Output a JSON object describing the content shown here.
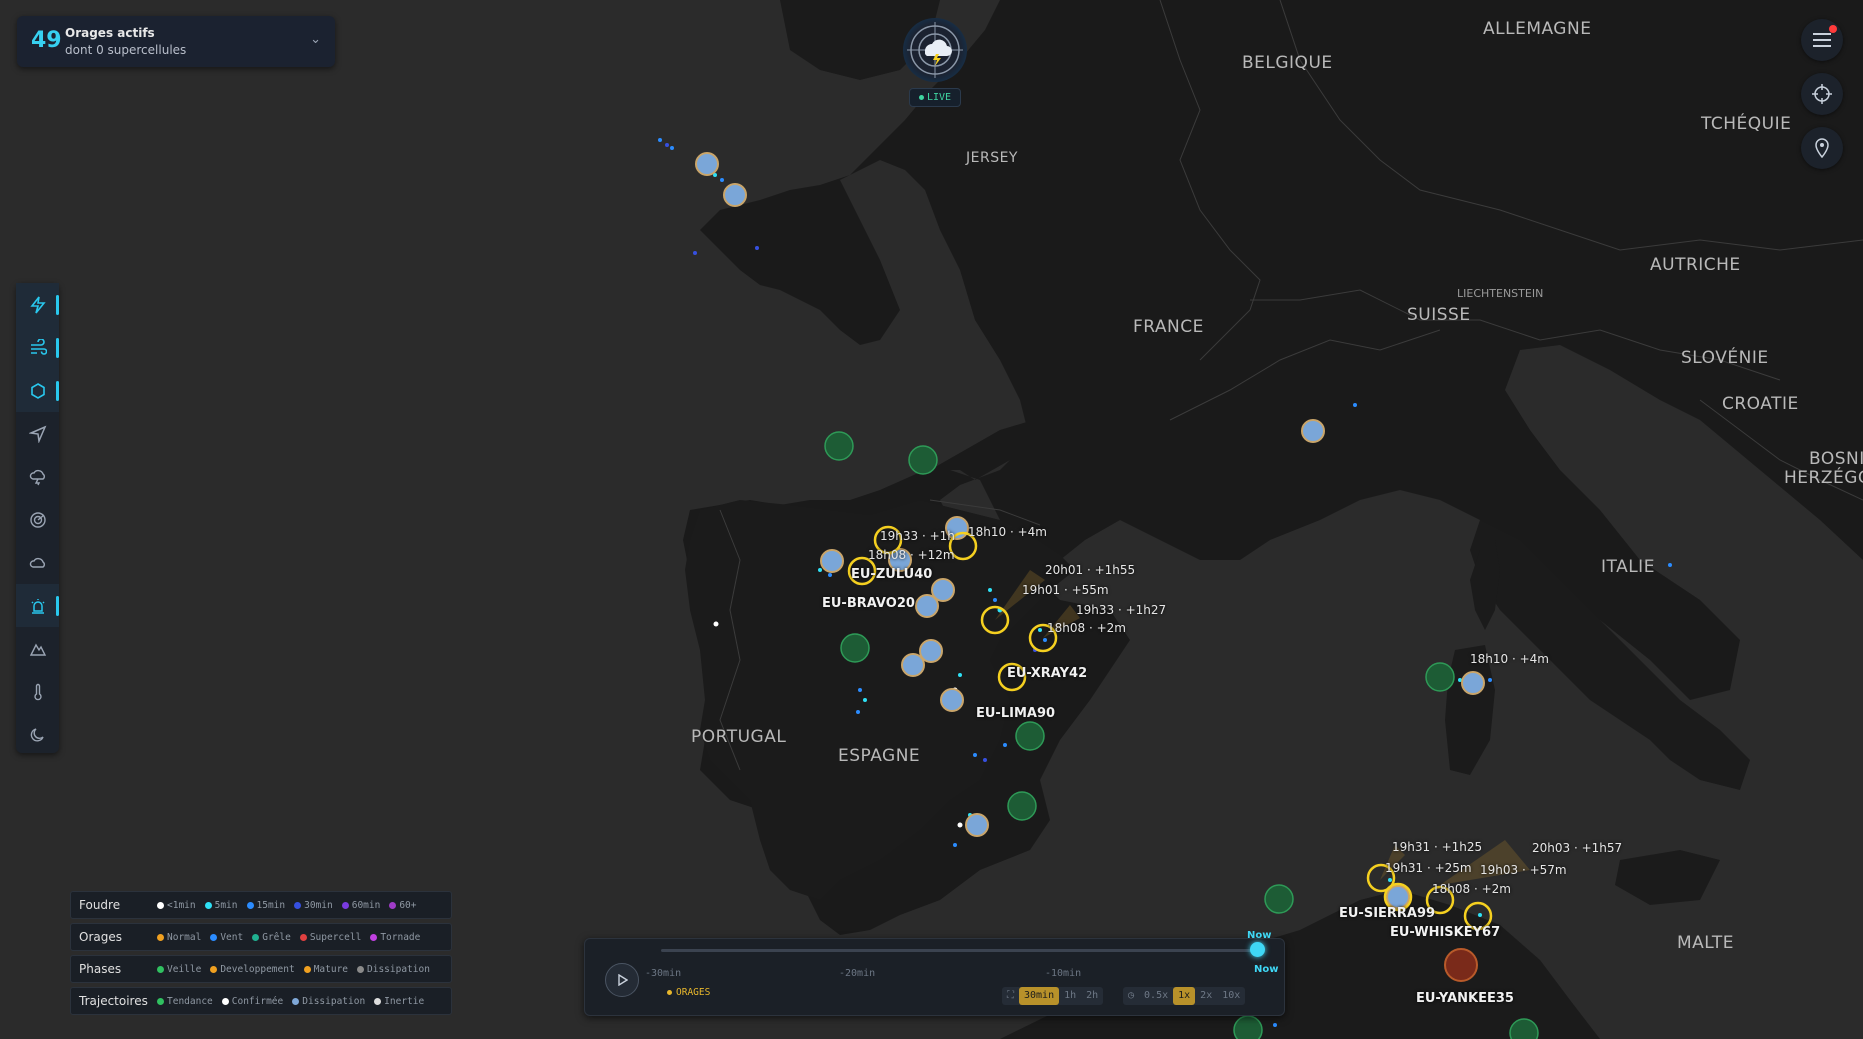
{
  "storm_card": {
    "count": "49",
    "title": "Orages actifs",
    "subtitle": "dont 0 supercellules"
  },
  "live": "LIVE",
  "countries": {
    "allemagne": "ALLEMAGNE",
    "belgique": "BELGIQUE",
    "tcheque": "TCHÉQUIE",
    "jersey": "JERSEY",
    "france": "FRANCE",
    "suisse": "SUISSE",
    "liechtenstein": "LIECHTENSTEIN",
    "autriche": "AUTRICHE",
    "slovenie": "SLOVÉNIE",
    "croatie": "CROATIE",
    "bosnie1": "BOSNIE-",
    "bosnie2": "HERZÉGOV",
    "italie": "ITALIE",
    "portugal": "PORTUGAL",
    "espagne": "ESPAGNE",
    "malte": "MALTE"
  },
  "storms": {
    "zulu": "EU-ZULU40",
    "bravo": "EU-BRAVO20",
    "xray": "EU-XRAY42",
    "lima": "EU-LIMA90",
    "sierra": "EU-SIERRA99",
    "whiskey": "EU-WHISKEY67",
    "yankee": "EU-YANKEE35"
  },
  "tracks": {
    "t1": "19h33 · +1h",
    "t2": "18h10 · +4m",
    "t3": "18h08 · +12m",
    "t4": "20h01 · +1h55",
    "t5": "19h01 · +55m",
    "t6": "19h33 · +1h27",
    "t7": "18h08 · +2m",
    "t8": "18h10 · +4m",
    "t9": "19h31 · +1h25",
    "t10": "20h03 · +1h57",
    "t11": "19h31 · +25m",
    "t12": "19h03 · +57m",
    "t13": "18h08 · +2m"
  },
  "toolbar": {
    "items": [
      {
        "icon": "lightning-icon",
        "active": true
      },
      {
        "icon": "wind-icon",
        "active": true
      },
      {
        "icon": "hexagon-icon",
        "active": true
      },
      {
        "icon": "navigation-icon",
        "active": false
      },
      {
        "icon": "storm-cloud-icon",
        "active": false
      },
      {
        "icon": "radar-icon",
        "active": false
      },
      {
        "icon": "cloud-icon",
        "active": false
      },
      {
        "icon": "alert-siren-icon",
        "active": true
      },
      {
        "icon": "mountain-icon",
        "active": false
      },
      {
        "icon": "thermometer-icon",
        "active": false
      },
      {
        "icon": "moon-icon",
        "active": false
      }
    ]
  },
  "legend": {
    "foudre": {
      "title": "Foudre",
      "items": [
        {
          "label": "<1min",
          "color": "#ffffff"
        },
        {
          "label": "5min",
          "color": "#2ee0f5"
        },
        {
          "label": "15min",
          "color": "#2b8cff"
        },
        {
          "label": "30min",
          "color": "#3650e0"
        },
        {
          "label": "60min",
          "color": "#7a3be0"
        },
        {
          "label": "60+",
          "color": "#a03cc8"
        }
      ]
    },
    "orages": {
      "title": "Orages",
      "items": [
        {
          "label": "Normal",
          "color": "#f0a020"
        },
        {
          "label": "Vent",
          "color": "#2b8cff"
        },
        {
          "label": "Grêle",
          "color": "#20b090"
        },
        {
          "label": "Supercell",
          "color": "#e04040"
        },
        {
          "label": "Tornade",
          "color": "#c040e0"
        }
      ]
    },
    "phases": {
      "title": "Phases",
      "items": [
        {
          "label": "Veille",
          "color": "#30c060"
        },
        {
          "label": "Developpement",
          "color": "#f0a020"
        },
        {
          "label": "Mature",
          "color": "#f0a020"
        },
        {
          "label": "Dissipation",
          "color": "#8a8a8a"
        }
      ]
    },
    "trajectoires": {
      "title": "Trajectoires",
      "items": [
        {
          "label": "Tendance",
          "color": "#30c060"
        },
        {
          "label": "Confirmée",
          "color": "#ffffff"
        },
        {
          "label": "Dissipation",
          "color": "#7fa8d8"
        },
        {
          "label": "Inertie",
          "color": "#dddddd"
        }
      ]
    }
  },
  "timeline": {
    "ticks": [
      "-30min",
      "-20min",
      "-10min"
    ],
    "now_top": "Now",
    "now_bottom": "Now",
    "layer": "ORAGES",
    "ranges": [
      "30min",
      "1h",
      "2h"
    ],
    "speeds": [
      "0.5x",
      "1x",
      "2x",
      "10x"
    ],
    "active_range": "30min",
    "active_speed": "1x",
    "progress": 1.0
  }
}
